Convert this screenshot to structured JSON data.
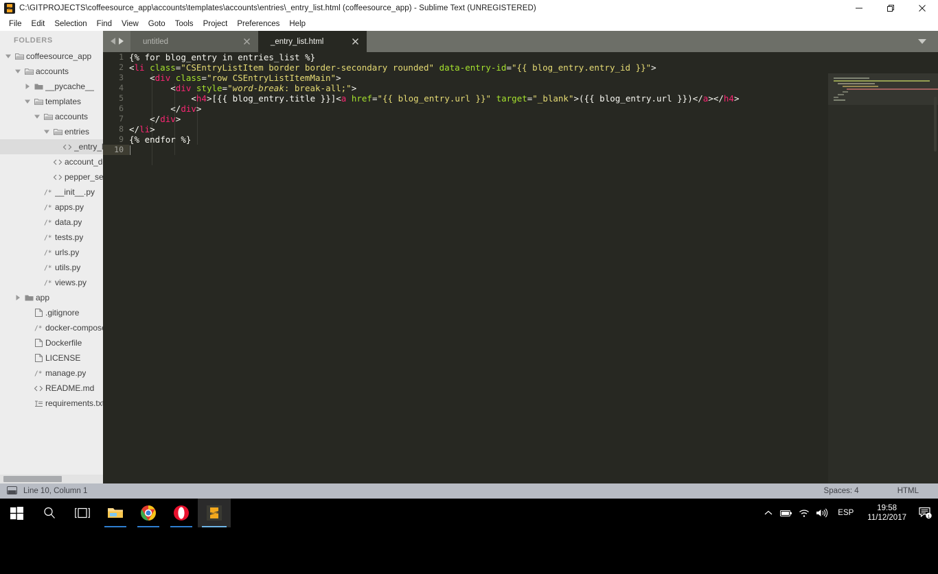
{
  "window": {
    "title": "C:\\GITPROJECTS\\coffeesource_app\\accounts\\templates\\accounts\\entries\\_entry_list.html (coffeesource_app) - Sublime Text (UNREGISTERED)",
    "app_icon": "sublime-text-icon",
    "controls": {
      "minimize": "minimize-icon",
      "maximize": "restore-icon",
      "close": "close-icon"
    }
  },
  "menubar": {
    "items": [
      {
        "label": "File"
      },
      {
        "label": "Edit"
      },
      {
        "label": "Selection"
      },
      {
        "label": "Find"
      },
      {
        "label": "View"
      },
      {
        "label": "Goto"
      },
      {
        "label": "Tools"
      },
      {
        "label": "Project"
      },
      {
        "label": "Preferences"
      },
      {
        "label": "Help"
      }
    ]
  },
  "sidebar": {
    "heading": "FOLDERS",
    "items": [
      {
        "label": "coffeesource_app",
        "depth": 0,
        "type": "folder",
        "state": "open",
        "icon": "folder-open-icon",
        "selected": false
      },
      {
        "label": "accounts",
        "depth": 1,
        "type": "folder",
        "state": "open",
        "icon": "folder-open-icon",
        "selected": false
      },
      {
        "label": "__pycache__",
        "depth": 2,
        "type": "folder",
        "state": "closed",
        "icon": "folder-closed-icon",
        "selected": false
      },
      {
        "label": "templates",
        "depth": 2,
        "type": "folder",
        "state": "open",
        "icon": "folder-open-icon",
        "selected": false
      },
      {
        "label": "accounts",
        "depth": 3,
        "type": "folder",
        "state": "open",
        "icon": "folder-open-icon",
        "selected": false
      },
      {
        "label": "entries",
        "depth": 4,
        "type": "folder",
        "state": "open",
        "icon": "folder-open-icon",
        "selected": false
      },
      {
        "label": "_entry_list.html",
        "depth": 5,
        "type": "file",
        "state": "",
        "icon": "html-file-icon",
        "selected": true
      },
      {
        "label": "account_detail.html",
        "depth": 4,
        "type": "file",
        "state": "",
        "icon": "html-file-icon",
        "selected": false
      },
      {
        "label": "pepper_search.html",
        "depth": 4,
        "type": "file",
        "state": "",
        "icon": "html-file-icon",
        "selected": false
      },
      {
        "label": "__init__.py",
        "depth": 3,
        "type": "file",
        "state": "",
        "icon": "python-file-icon",
        "selected": false
      },
      {
        "label": "apps.py",
        "depth": 3,
        "type": "file",
        "state": "",
        "icon": "python-file-icon",
        "selected": false
      },
      {
        "label": "data.py",
        "depth": 3,
        "type": "file",
        "state": "",
        "icon": "python-file-icon",
        "selected": false
      },
      {
        "label": "tests.py",
        "depth": 3,
        "type": "file",
        "state": "",
        "icon": "python-file-icon",
        "selected": false
      },
      {
        "label": "urls.py",
        "depth": 3,
        "type": "file",
        "state": "",
        "icon": "python-file-icon",
        "selected": false
      },
      {
        "label": "utils.py",
        "depth": 3,
        "type": "file",
        "state": "",
        "icon": "python-file-icon",
        "selected": false
      },
      {
        "label": "views.py",
        "depth": 3,
        "type": "file",
        "state": "",
        "icon": "python-file-icon",
        "selected": false
      },
      {
        "label": "app",
        "depth": 1,
        "type": "folder",
        "state": "closed",
        "icon": "folder-closed-icon",
        "selected": false
      },
      {
        "label": ".gitignore",
        "depth": 2,
        "type": "file",
        "state": "",
        "icon": "plain-file-icon",
        "selected": false
      },
      {
        "label": "docker-compose.yml",
        "depth": 2,
        "type": "file",
        "state": "",
        "icon": "python-file-icon",
        "selected": false
      },
      {
        "label": "Dockerfile",
        "depth": 2,
        "type": "file",
        "state": "",
        "icon": "plain-file-icon",
        "selected": false
      },
      {
        "label": "LICENSE",
        "depth": 2,
        "type": "file",
        "state": "",
        "icon": "plain-file-icon",
        "selected": false
      },
      {
        "label": "manage.py",
        "depth": 2,
        "type": "file",
        "state": "",
        "icon": "python-file-icon",
        "selected": false
      },
      {
        "label": "README.md",
        "depth": 2,
        "type": "file",
        "state": "",
        "icon": "html-file-icon",
        "selected": false
      },
      {
        "label": "requirements.txt",
        "depth": 2,
        "type": "file",
        "state": "",
        "icon": "text-file-icon",
        "selected": false
      }
    ]
  },
  "tabs": {
    "nav_prev_icon": "chevron-left-icon",
    "nav_next_icon": "chevron-right-icon",
    "menu_icon": "chevron-down-icon",
    "items": [
      {
        "label": "untitled",
        "active": false,
        "close_icon": "close-icon"
      },
      {
        "label": "_entry_list.html",
        "active": true,
        "close_icon": "close-icon"
      }
    ]
  },
  "editor": {
    "line_numbers": [
      "1",
      "2",
      "3",
      "4",
      "5",
      "6",
      "7",
      "8",
      "9",
      "10"
    ],
    "current_line": 10,
    "lines": [
      "{% for blog_entry in entries_list %}",
      "<li class=\"CSEntryListItem border border-secondary rounded\" data-entry-id=\"{{ blog_entry.entry_id }}\">",
      "    <div class=\"row CSEntryListItemMain\">",
      "        <div style=\"word-break: break-all;\">",
      "            <h4>[{{ blog_entry.title }}]<a href=\"{{ blog_entry.url }}\" target=\"_blank\">({{ blog_entry.url }})</a></h4>",
      "        </div>",
      "    </div>",
      "</li>",
      "{% endfor %}",
      ""
    ]
  },
  "statusbar": {
    "sidebar_toggle_icon": "sidebar-toggle-icon",
    "position": "Line 10, Column 1",
    "indentation": "Spaces: 4",
    "syntax": "HTML"
  },
  "taskbar": {
    "start_icon": "windows-start-icon",
    "search_icon": "search-icon",
    "taskview_icon": "task-view-icon",
    "apps": [
      {
        "name": "file-explorer-icon",
        "running": true,
        "active": false
      },
      {
        "name": "google-chrome-icon",
        "running": true,
        "active": false
      },
      {
        "name": "opera-icon",
        "running": true,
        "active": false
      },
      {
        "name": "sublime-text-icon",
        "running": true,
        "active": true
      }
    ],
    "tray": {
      "overflow_icon": "chevron-up-icon",
      "battery_icon": "battery-icon",
      "wifi_icon": "wifi-icon",
      "volume_icon": "volume-icon",
      "language": "ESP",
      "time": "19:58",
      "date": "11/12/2017",
      "action_center_icon": "action-center-icon",
      "notification_count": "1"
    }
  },
  "colors": {
    "editor_bg": "#272822",
    "sidebar_bg": "#ededed",
    "tabbar_bg": "#6d6f68",
    "statusbar_bg": "#b8bcc4",
    "tag": "#f92672",
    "attr": "#a6e22e",
    "string": "#e6db74",
    "text": "#f8f8f2",
    "linenum": "#717269"
  }
}
